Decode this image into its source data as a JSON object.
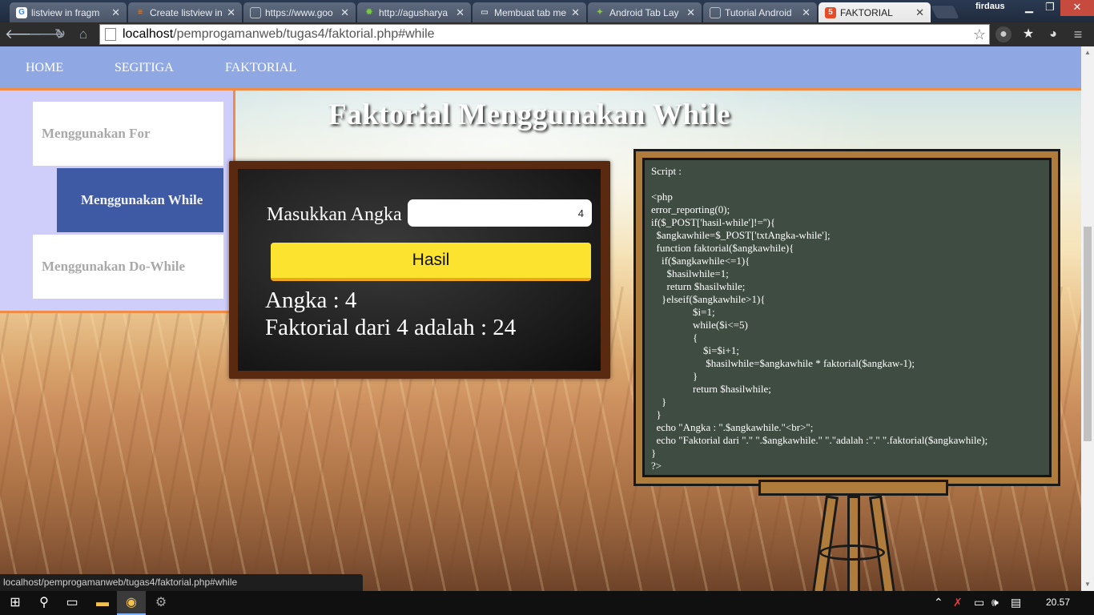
{
  "browser": {
    "tabs": [
      {
        "title": "listview in fragm",
        "favicon": "google-icon",
        "color": "#4285f4",
        "glyph": "G"
      },
      {
        "title": "Create listview in",
        "favicon": "stackoverflow-icon",
        "color": "#f48024",
        "glyph": "≡"
      },
      {
        "title": "https://www.goo",
        "favicon": "page-icon",
        "color": "#9aa3ad",
        "glyph": ""
      },
      {
        "title": "http://agusharya",
        "favicon": "gear-icon",
        "color": "#7ac943",
        "glyph": "✹"
      },
      {
        "title": "Membuat tab me",
        "favicon": "blogger-icon",
        "color": "#6f7a86",
        "glyph": "▭"
      },
      {
        "title": "Android Tab Lay",
        "favicon": "android-icon",
        "color": "#8bc34a",
        "glyph": "✦"
      },
      {
        "title": "Tutorial Android",
        "favicon": "page-icon",
        "color": "#9aa3ad",
        "glyph": ""
      },
      {
        "title": "FAKTORIAL",
        "favicon": "html5-icon",
        "color": "#e34c26",
        "glyph": "5"
      }
    ],
    "profile_name": "firdaus",
    "url_host": "localhost",
    "url_path": "/pemprogamanweb/tugas4/faktorial.php#while",
    "status_url": "localhost/pemprogamanweb/tugas4/faktorial.php#while"
  },
  "nav": {
    "home": "HOME",
    "segitiga": "SEGITIGA",
    "faktorial": "FAKTORIAL"
  },
  "sidebar": {
    "items": [
      {
        "label": "Menggunakan For",
        "active": false
      },
      {
        "label": "Menggunakan While",
        "active": true
      },
      {
        "label": "Menggunakan Do-While",
        "active": false
      }
    ]
  },
  "page_title": "Faktorial Menggunakan While",
  "form": {
    "label": "Masukkan Angka",
    "input_value": "4",
    "button_label": "Hasil",
    "result_angka": "Angka : 4",
    "result_faktorial": "Faktorial dari 4 adalah : 24"
  },
  "script": {
    "heading": "Script :",
    "code": "<php\nerror_reporting(0);\nif($_POST['hasil-while']!=''){\n  $angkawhile=$_POST['txtAngka-while'];\n  function faktorial($angkawhile){\n    if($angkawhile<=1){\n      $hasilwhile=1;\n      return $hasilwhile;\n    }elseif($angkawhile>1){\n                $i=1;\n                while($i<=5)\n                {\n                    $i=$i+1;\n                     $hasilwhile=$angkawhile * faktorial($angkaw-1);\n                }\n                return $hasilwhile;\n    }\n  }\n  echo \"Angka : \".$angkawhile.\"<br>\";\n  echo \"Faktorial dari \".\" \".$angkawhile.\" \".\"adalah :\".\" \".faktorial($angkawhile);\n}\n?>"
  },
  "taskbar": {
    "clock": "20.57"
  },
  "colors": {
    "nav_bg": "#8fa8e3",
    "accent_border": "#f08c45",
    "sidebar_bg": "#cfcdfa",
    "active_item": "#3e5aa5",
    "button_yellow": "#fce330",
    "board_green": "#3f4c42",
    "frame_wood": "#b07c3c"
  }
}
